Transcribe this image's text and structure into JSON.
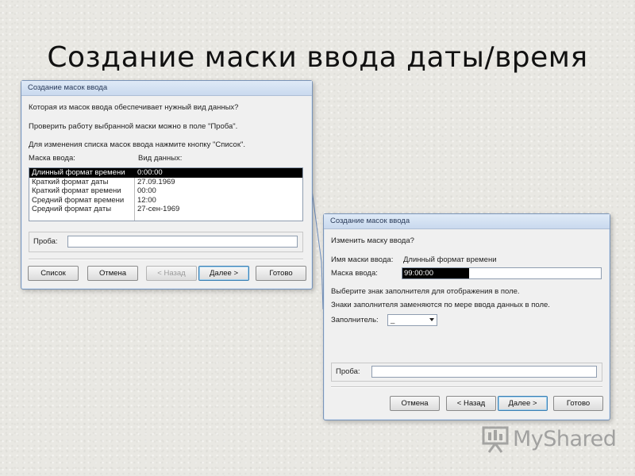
{
  "slide": {
    "title": "Создание маски ввода даты/время"
  },
  "dialog1": {
    "title": "Создание масок ввода",
    "line1": "Которая из масок ввода обеспечивает нужный вид данных?",
    "line2": "Проверить работу выбранной маски можно в поле \"Проба\".",
    "line3": "Для изменения списка масок ввода нажмите кнопку \"Список\".",
    "col_mask": "Маска ввода:",
    "col_data": "Вид данных:",
    "rows": [
      {
        "mask": "Длинный формат времени",
        "data": "0:00:00",
        "selected": true
      },
      {
        "mask": "Краткий формат даты",
        "data": "27.09.1969"
      },
      {
        "mask": "Краткий формат времени",
        "data": "00:00"
      },
      {
        "mask": "Средний формат времени",
        "data": "12:00"
      },
      {
        "mask": "Средний формат даты",
        "data": "27-сен-1969"
      }
    ],
    "test_label": "Проба:",
    "test_value": "",
    "buttons": {
      "list": "Список",
      "cancel": "Отмена",
      "back": "< Назад",
      "next": "Далее >",
      "finish": "Готово"
    }
  },
  "dialog2": {
    "title": "Создание масок ввода",
    "question": "Изменить маску ввода?",
    "mask_name_label": "Имя маски ввода:",
    "mask_name_value": "Длинный формат времени",
    "mask_label": "Маска ввода:",
    "mask_value": "99:00:00",
    "hint1": "Выберите знак заполнителя для отображения в поле.",
    "hint2": "Знаки заполнителя заменяются по мере ввода данных в поле.",
    "placeholder_label": "Заполнитель:",
    "placeholder_value": "_",
    "test_label": "Проба:",
    "test_value": "",
    "buttons": {
      "cancel": "Отмена",
      "back": "< Назад",
      "next": "Далее >",
      "finish": "Готово"
    }
  },
  "watermark": {
    "text": "MyShared"
  },
  "colors": {
    "title_bar": "#c9d9ee",
    "selection": "#000000",
    "accent": "#3c7fb1"
  }
}
